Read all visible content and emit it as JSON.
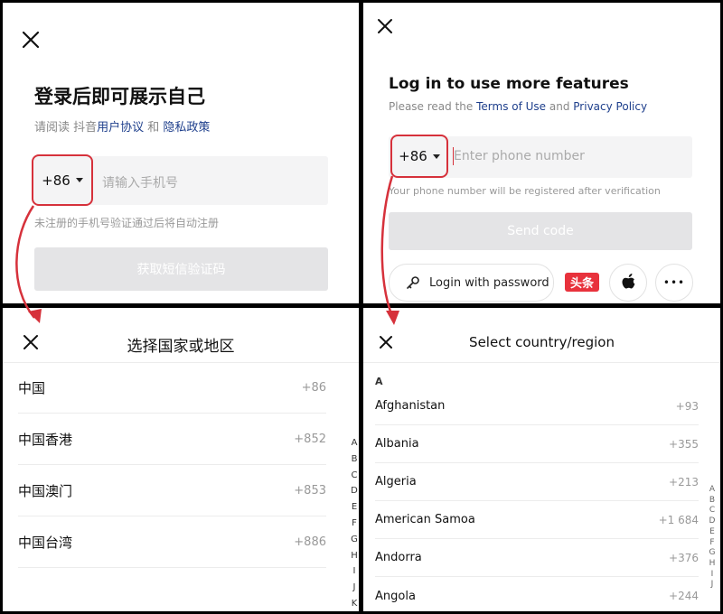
{
  "cn_login": {
    "title": "登录后即可展示自己",
    "agreement_prefix": "请阅读 抖音",
    "user_agreement": "用户协议",
    "and": " 和 ",
    "privacy_policy": "隐私政策",
    "country_code": "+86",
    "phone_placeholder": "请输入手机号",
    "hint": "未注册的手机号验证通过后将自动注册",
    "submit_label": "获取短信验证码"
  },
  "en_login": {
    "title": "Log in to use more features",
    "agreement_prefix": "Please read the ",
    "terms": "Terms of Use",
    "and": "  and ",
    "privacy_policy": "Privacy Policy",
    "country_code": "+86",
    "phone_placeholder": "Enter phone number",
    "hint": "Your phone number will be registered after verification",
    "send_code_label": "Send code",
    "login_with_password": "Login with password",
    "toutiao_label": "头条",
    "more_label": "•••"
  },
  "cn_region": {
    "title": "选择国家或地区",
    "rows": [
      {
        "name": "中国",
        "code": "+86"
      },
      {
        "name": "中国香港",
        "code": "+852"
      },
      {
        "name": "中国澳门",
        "code": "+853"
      },
      {
        "name": "中国台湾",
        "code": "+886"
      }
    ],
    "index": [
      "A",
      "B",
      "C",
      "D",
      "E",
      "F",
      "G",
      "H",
      "I",
      "J",
      "K"
    ]
  },
  "en_region": {
    "title": "Select country/region",
    "section": "A",
    "rows": [
      {
        "name": "Afghanistan",
        "code": "+93"
      },
      {
        "name": "Albania",
        "code": "+355"
      },
      {
        "name": "Algeria",
        "code": "+213"
      },
      {
        "name": "American Samoa",
        "code": "+1 684"
      },
      {
        "name": "Andorra",
        "code": "+376"
      },
      {
        "name": "Angola",
        "code": "+244"
      }
    ],
    "index": [
      "A",
      "B",
      "C",
      "D",
      "E",
      "F",
      "G",
      "H",
      "I",
      "J"
    ]
  },
  "colors": {
    "highlight": "#d6313b",
    "link": "#1e3f8c",
    "toutiao": "#e8323c"
  },
  "icons": [
    "close-icon",
    "key-icon",
    "apple-icon",
    "more-icon",
    "caret-down-icon"
  ]
}
